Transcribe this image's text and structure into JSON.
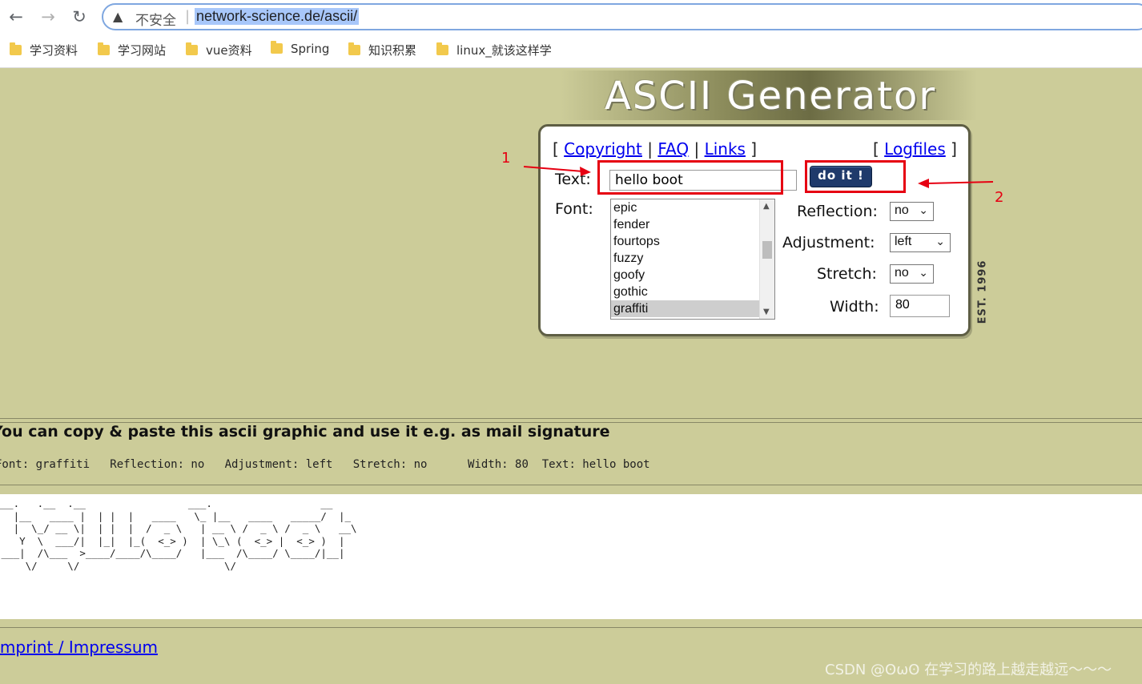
{
  "browser": {
    "back_icon": "arrow-left-icon",
    "forward_icon": "arrow-right-icon",
    "reload_icon": "reload-icon",
    "security_label": "不安全",
    "url": "network-science.de/ascii/",
    "bookmarks": [
      "学习资料",
      "学习网站",
      "vue资料",
      "Spring",
      "知识积累",
      "linux_就该这样学"
    ]
  },
  "header": {
    "logo_text": "ASCII Generator",
    "est_text": "EST. 1996"
  },
  "links": {
    "copyright": "Copyright",
    "faq": "FAQ",
    "links": "Links",
    "logfiles": "Logfiles"
  },
  "form": {
    "text_label": "Text:",
    "text_value": "hello boot",
    "doit_label": "do it !",
    "font_label": "Font:",
    "fonts": [
      "epic",
      "fender",
      "fourtops",
      "fuzzy",
      "goofy",
      "gothic",
      "graffiti"
    ],
    "selected_font": "graffiti",
    "reflection_label": "Reflection:",
    "reflection_value": "no",
    "adjustment_label": "Adjustment:",
    "adjustment_value": "left",
    "stretch_label": "Stretch:",
    "stretch_value": "no",
    "width_label": "Width:",
    "width_value": "80"
  },
  "annotations": {
    "one": "1",
    "two": "2"
  },
  "result": {
    "copy_note": "You can copy & paste this ascii graphic and use it e.g. as mail signature",
    "params_line": "Font: graffiti   Reflection: no   Adjustment: left   Stretch: no      Width: 80  Text: hello boot",
    "ascii_art": "___.   .__  .__                 ___.                  __   \n|  |__   ____ |  | |  |   ____   \\_ |__   ____   _____/  |_ \n|  |  \\_/ __ \\|  | |  |  /  _ \\   | __ \\ /  _ \\ /  _ \\   __\\\n|   Y  \\  ___/|  |_|  |_(  <_> )  | \\_\\ (  <_> |  <_> )  |  \n|___|  /\\___  >____/____/\\____/   |___  /\\____/ \\____/|__|  \n     \\/     \\/                        \\/                    "
  },
  "footer": {
    "imprint": "Imprint / Impressum",
    "watermark": "CSDN @ʘωʘ 在学习的路上越走越远～～～"
  }
}
